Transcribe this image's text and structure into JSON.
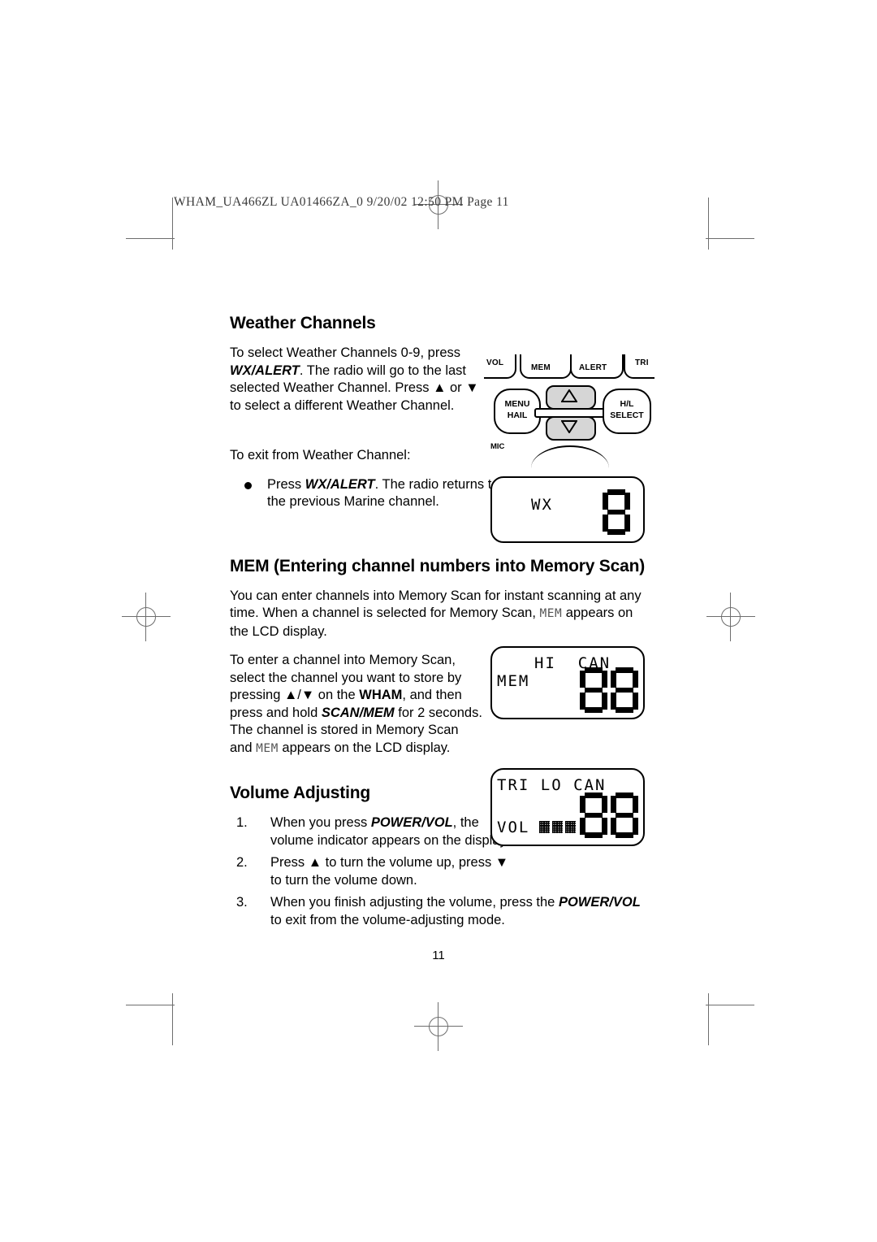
{
  "imposition": {
    "slug": "WHAM_UA466ZL UA01466ZA_0  9/20/02  12:50 PM  Page 11"
  },
  "sections": {
    "weather": {
      "heading": "Weather Channels",
      "para_1_a": "To select Weather Channels 0-9, press ",
      "para_1_b": "WX/ALERT",
      "para_1_c": ".  The radio will go to the last selected Weather Channel.  Press ▲ or ▼ to select a different Weather Channel.",
      "exit_line": "To exit from Weather Channel:",
      "bullet_a": "Press ",
      "bullet_b": "WX/ALERT",
      "bullet_c": ".  The radio returns to the previous Marine channel."
    },
    "mem": {
      "heading": "MEM (Entering channel numbers into Memory Scan)",
      "para_1_a": "You can enter channels into Memory Scan for instant scanning at any time. When a channel is selected for Memory Scan, ",
      "para_1_lcd": "MEM",
      "para_1_b": " appears on the LCD display.",
      "para_2_a": "To enter a channel into Memory Scan, select the channel you want to store by pressing ▲/▼ on the ",
      "para_2_b": "WHAM",
      "para_2_c": ", and then press and hold ",
      "para_2_d": "SCAN/MEM",
      "para_2_e": " for 2 seconds. The channel is stored in Memory Scan and ",
      "para_2_lcd": "MEM",
      "para_2_f": " appears on the LCD display."
    },
    "volume": {
      "heading": "Volume Adjusting",
      "steps": [
        {
          "num": "1.",
          "text_a": "When you press ",
          "text_b": "POWER/VOL",
          "text_c": ", the volume indicator appears on the display."
        },
        {
          "num": "2.",
          "text_a": "Press ▲ to turn the volume up, press ▼ to turn the volume down.",
          "text_b": "",
          "text_c": ""
        },
        {
          "num": "3.",
          "text_a": "When you finish adjusting the volume, press the ",
          "text_b": "POWER/VOL",
          "text_c": " to exit from the volume-adjusting mode."
        }
      ]
    }
  },
  "keypad": {
    "top_labels": [
      "VOL",
      "MEM",
      "ALERT",
      "TRI"
    ],
    "left_key_line1": "MENU",
    "left_key_line2": "HAIL",
    "right_key_line1": "H/L",
    "right_key_line2": "SELECT",
    "mic_label": "MIC",
    "up_arrow": "▲",
    "down_arrow": "▼"
  },
  "lcd_displays": [
    {
      "id": "wx-display",
      "top_text": "WX",
      "left_text": "",
      "bottom_text": "",
      "digits": "8",
      "vol_blocks": 0
    },
    {
      "id": "mem-display",
      "top_text": "HI  CAN",
      "left_text": "MEM",
      "bottom_text": "",
      "digits": "88",
      "vol_blocks": 0
    },
    {
      "id": "volume-display",
      "top_text": "TRI LO CAN",
      "left_text": "",
      "bottom_text": "VOL",
      "digits": "88",
      "vol_blocks": 3
    }
  ],
  "footer": {
    "page_number": "11"
  }
}
